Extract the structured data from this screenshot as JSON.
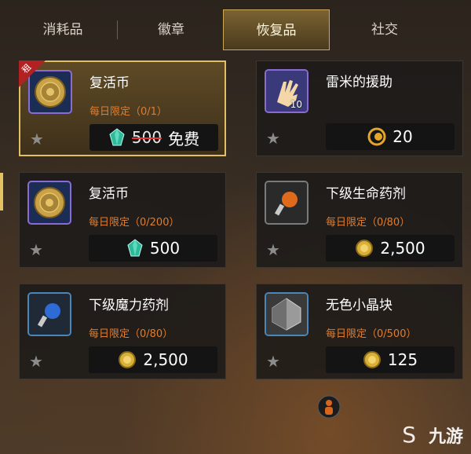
{
  "tabs": [
    {
      "label": "消耗品",
      "active": false
    },
    {
      "label": "徽章",
      "active": false
    },
    {
      "label": "恢复品",
      "active": true
    },
    {
      "label": "社交",
      "active": false
    }
  ],
  "items": [
    {
      "name": "复活币",
      "limit": "每日限定（0/1）",
      "price": "500",
      "original_price": "500",
      "price_label": "免费",
      "currency": "gem-icon",
      "badge": "租",
      "highlight": true
    },
    {
      "name": "雷米的援助",
      "limit": "",
      "price": "20",
      "quantity": "10",
      "currency": "crescent-coin-icon",
      "highlight": false
    },
    {
      "name": "复活币",
      "limit": "每日限定（0/200）",
      "price": "500",
      "currency": "gem-icon",
      "highlight": false
    },
    {
      "name": "下级生命药剂",
      "limit": "每日限定（0/80）",
      "price": "2,500",
      "currency": "gold-coin-icon",
      "highlight": false
    },
    {
      "name": "下级魔力药剂",
      "limit": "每日限定（0/80）",
      "price": "2,500",
      "currency": "gold-coin-icon",
      "highlight": false
    },
    {
      "name": "无色小晶块",
      "limit": "每日限定（0/500）",
      "price": "125",
      "currency": "gold-coin-icon",
      "highlight": false
    }
  ],
  "watermark": "九游",
  "colors": {
    "accent": "#e0c060",
    "limit": "#e07d2f",
    "gem": "#2fb89a",
    "gold": "#d9b03a"
  }
}
